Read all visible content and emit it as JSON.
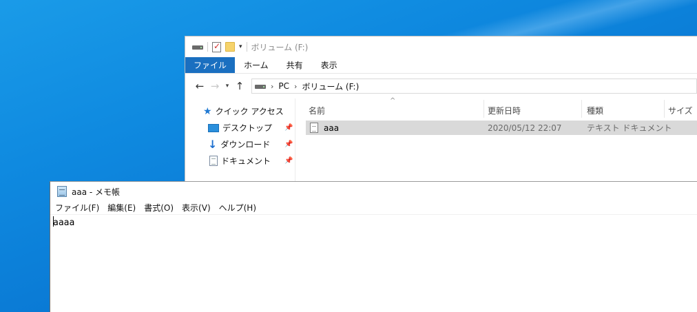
{
  "explorer": {
    "title": "ボリューム (F:)",
    "ribbon_tabs": [
      "ファイル",
      "ホーム",
      "共有",
      "表示"
    ],
    "address": {
      "segments": [
        "PC",
        "ボリューム (F:)"
      ]
    },
    "nav": {
      "quick_access": "クイック アクセス",
      "items": [
        {
          "label": "デスクトップ",
          "icon": "desktop-icon"
        },
        {
          "label": "ダウンロード",
          "icon": "download-icon"
        },
        {
          "label": "ドキュメント",
          "icon": "document-icon"
        }
      ]
    },
    "columns": {
      "name": "名前",
      "modified": "更新日時",
      "type": "種類",
      "size": "サイズ"
    },
    "files": [
      {
        "name": "aaa",
        "modified": "2020/05/12 22:07",
        "type": "テキスト ドキュメント"
      }
    ]
  },
  "notepad": {
    "title": "aaa - メモ帳",
    "menu": [
      "ファイル(F)",
      "編集(E)",
      "書式(O)",
      "表示(V)",
      "ヘルプ(H)"
    ],
    "content": "aaaa"
  },
  "colors": {
    "desktop": "#0f8ae0",
    "file_tab": "#1a6fc0",
    "selected_row": "#d9d9d9"
  }
}
